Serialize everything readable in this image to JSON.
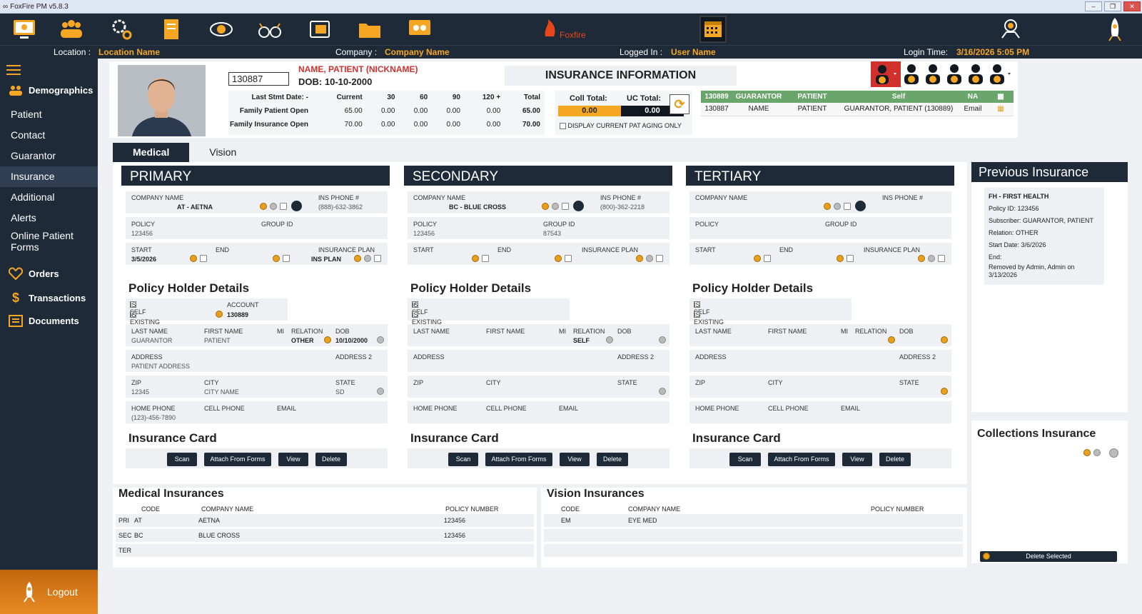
{
  "window": {
    "title": "FoxFire PM v5.8.3"
  },
  "toolbar": {
    "icons": [
      "dashboard-icon",
      "patients-icon",
      "settings-icon",
      "notes-icon",
      "eye-icon",
      "glasses-icon",
      "wallet-icon",
      "folder-icon",
      "optical-icon",
      "calendar-icon",
      "support-icon",
      "rocket-icon"
    ],
    "logo_text": "Foxfire"
  },
  "infobar": {
    "location_label": "Location :",
    "location_value": "Location Name",
    "company_label": "Company :",
    "company_value": "Company Name",
    "logged_label": "Logged In :",
    "logged_value": "User Name",
    "login_time_label": "Login Time:",
    "login_time_value": "3/16/2026 5:05 PM"
  },
  "sidebar": {
    "demographics": "Demographics",
    "items": [
      "Patient",
      "Contact",
      "Guarantor",
      "Insurance",
      "Additional",
      "Alerts",
      "Online Patient Forms"
    ],
    "active": "Insurance",
    "orders": "Orders",
    "transactions": "Transactions",
    "documents": "Documents",
    "logout": "Logout"
  },
  "patient": {
    "account": "130887",
    "name": "NAME, PATIENT (NICKNAME)",
    "dob_label": "DOB:",
    "dob": "10-10-2000"
  },
  "aging": {
    "headers": [
      "Last Stmt Date: -",
      "Current",
      "30",
      "60",
      "90",
      "120 +",
      "Total"
    ],
    "rows": [
      {
        "label": "Family Patient Open",
        "values": [
          "65.00",
          "0.00",
          "0.00",
          "0.00",
          "0.00",
          "65.00"
        ]
      },
      {
        "label": "Family Insurance Open",
        "values": [
          "70.00",
          "0.00",
          "0.00",
          "0.00",
          "0.00",
          "70.00"
        ]
      }
    ]
  },
  "insurance_info_title": "INSURANCE INFORMATION",
  "collections": {
    "coll_label": "Coll Total:",
    "coll_value": "0.00",
    "uc_label": "UC Total:",
    "uc_value": "0.00",
    "display_current": "DISPLAY CURRENT PAT AGING ONLY"
  },
  "guarantor_table": {
    "headers": [
      "130889",
      "GUARANTOR",
      "PATIENT",
      "Self",
      "NA"
    ],
    "row": [
      "130887",
      "NAME",
      "PATIENT",
      "GUARANTOR, PATIENT (130889)",
      "Email"
    ]
  },
  "tabs": [
    "Medical",
    "Vision"
  ],
  "labels": {
    "company_name": "COMPANY NAME",
    "ins_phone": "INS PHONE #",
    "policy": "POLICY",
    "group_id": "GROUP ID",
    "start": "START",
    "end": "END",
    "insurance_plan": "INSURANCE PLAN",
    "policy_holder": "Policy Holder Details",
    "is_self": "IS SELF",
    "is_existing": "IS EXISTING PATIENT",
    "account": "ACCOUNT",
    "last_name": "LAST NAME",
    "first_name": "FIRST NAME",
    "mi": "MI",
    "relation": "RELATION",
    "dob": "DOB",
    "address": "ADDRESS",
    "address2": "ADDRESS 2",
    "zip": "ZIP",
    "city": "CITY",
    "state": "STATE",
    "home_phone": "HOME PHONE",
    "cell_phone": "CELL PHONE",
    "email": "EMAIL",
    "insurance_card": "Insurance Card",
    "scan": "Scan",
    "attach": "Attach From Forms",
    "view": "View",
    "delete": "Delete"
  },
  "primary": {
    "title": "PRIMARY",
    "company": "AT - AETNA",
    "phone": "(888)-632-3862",
    "policy": "123456",
    "group": "",
    "start": "3/5/2026",
    "plan": "INS PLAN",
    "account": "130889",
    "last": "GUARANTOR",
    "first": "PATIENT",
    "relation": "OTHER",
    "dob": "10/10/2000",
    "address": "PATIENT ADDRESS",
    "zip": "12345",
    "city": "CITY NAME",
    "state": "SD",
    "home": "(123)-456-7890"
  },
  "secondary": {
    "title": "SECONDARY",
    "company": "BC - BLUE CROSS",
    "phone": "(800)-362-2218",
    "policy": "123456",
    "group": "87543",
    "relation": "SELF"
  },
  "tertiary": {
    "title": "TERTIARY"
  },
  "previous_insurance": {
    "title": "Previous Insurance",
    "lines": [
      "FH - FIRST HEALTH",
      "Policy ID: 123456",
      "Subscriber: GUARANTOR, PATIENT",
      "Relation: OTHER",
      "Start Date: 3/6/2026",
      "End:",
      "Removed by Admin, Admin on 3/13/2026"
    ]
  },
  "collections_insurance": {
    "title": "Collections Insurance",
    "delete_selected": "Delete Selected"
  },
  "medical_insurances": {
    "title": "Medical Insurances",
    "headers": [
      "CODE",
      "COMPANY NAME",
      "POLICY NUMBER"
    ],
    "rows": [
      {
        "tag": "PRI",
        "code": "AT",
        "company": "AETNA",
        "policy": "123456"
      },
      {
        "tag": "SEC",
        "code": "BC",
        "company": "BLUE CROSS",
        "policy": "123456"
      },
      {
        "tag": "TER",
        "code": "",
        "company": "",
        "policy": ""
      }
    ]
  },
  "vision_insurances": {
    "title": "Vision Insurances",
    "headers": [
      "CODE",
      "COMPANY NAME",
      "POLICY NUMBER"
    ],
    "rows": [
      {
        "code": "EM",
        "company": "EYE MED",
        "policy": ""
      }
    ]
  }
}
